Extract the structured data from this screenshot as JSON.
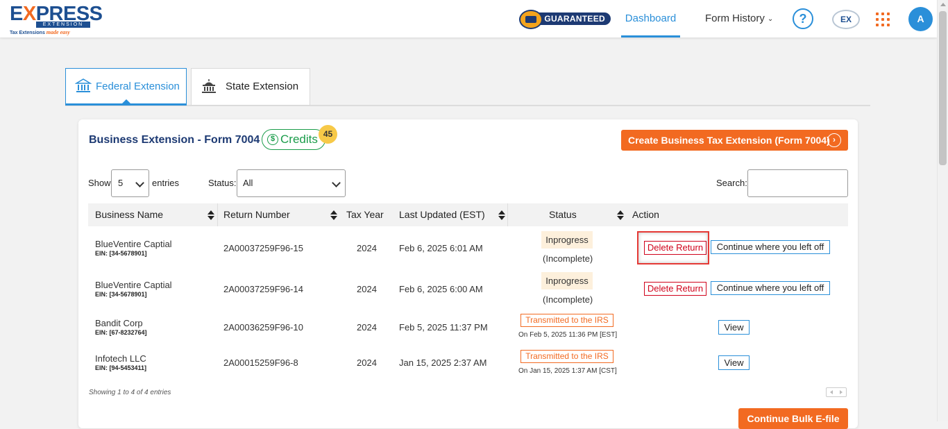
{
  "header": {
    "logo": {
      "brand_main": "E",
      "brand_x": "X",
      "brand_rest": "PRESS",
      "brand_sub": "EXTENSION",
      "tagline": "Tax Extensions",
      "tagline_script": "made easy"
    },
    "guaranteed_label": "GUARANTEED",
    "nav": {
      "dashboard": "Dashboard",
      "form_history": "Form History"
    },
    "help_icon_glyph": "?",
    "ex_icon_glyph": "EX",
    "avatar_initial": "A"
  },
  "tabs": [
    {
      "label": "Federal Extension",
      "active": true
    },
    {
      "label": "State Extension",
      "active": false
    }
  ],
  "card": {
    "title": "Business Extension - Form 7004",
    "credits_label": "Credits",
    "credits_count": "45",
    "create_button": "Create Business Tax Extension (Form 7004)"
  },
  "filters": {
    "show_label": "Show",
    "entries_value": "5",
    "entries_label": "entries",
    "status_label": "Status:",
    "status_value": "All",
    "search_label": "Search:",
    "search_value": ""
  },
  "table": {
    "columns": [
      "Business Name",
      "Return Number",
      "Tax Year",
      "Last Updated (EST)",
      "Status",
      "Action"
    ],
    "rows": [
      {
        "name": "BlueVentire Captial",
        "ein": "EIN: [34-5678901]",
        "return_number": "2A00037259F96-15",
        "tax_year": "2024",
        "updated": "Feb 6, 2025 6:01 AM",
        "status": "Inprogress",
        "status_sub": "(Incomplete)",
        "actions": [
          "Delete Return",
          "Continue where you left off"
        ]
      },
      {
        "name": "BlueVentire Captial",
        "ein": "EIN: [34-5678901]",
        "return_number": "2A00037259F96-14",
        "tax_year": "2024",
        "updated": "Feb 6, 2025 6:00 AM",
        "status": "Inprogress",
        "status_sub": "(Incomplete)",
        "actions": [
          "Delete Return",
          "Continue where you left off"
        ]
      },
      {
        "name": "Bandit Corp",
        "ein": "EIN: [67-8232764]",
        "return_number": "2A00036259F96-10",
        "tax_year": "2024",
        "updated": "Feb 5, 2025 11:37 PM",
        "status": "Transmitted to the IRS",
        "status_sub": "On Feb 5, 2025 11:36 PM [EST]",
        "actions": [
          "View"
        ]
      },
      {
        "name": "Infotech LLC",
        "ein": "EIN: [94-5453411]",
        "return_number": "2A00015259F96-8",
        "tax_year": "2024",
        "updated": "Jan 15, 2025 2:37 AM",
        "status": "Transmitted to the IRS",
        "status_sub": "On Jan 15, 2025 1:37 AM [CST]",
        "actions": [
          "View"
        ]
      }
    ]
  },
  "footer": {
    "showing": "Showing 1 to 4 of 4 entries",
    "bulk_button": "Continue Bulk E-file"
  },
  "colors": {
    "accent": "#2a8fd9",
    "brand": "#1d4f91",
    "orange": "#f26a21",
    "danger": "#d0021b",
    "success": "#1a9c4a"
  }
}
